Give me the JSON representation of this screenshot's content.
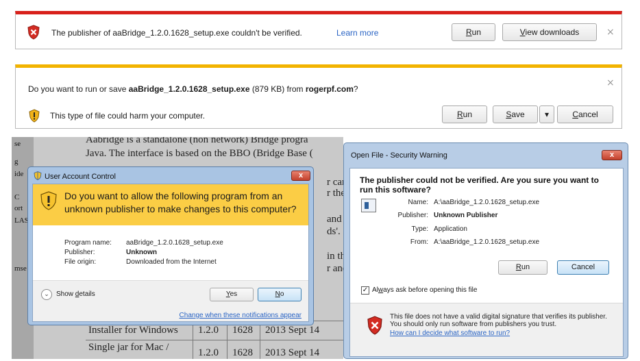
{
  "bar1": {
    "message": "The publisher of aaBridge_1.2.0.1628_setup.exe couldn't be verified.",
    "learn_more": "Learn more",
    "run_u": "R",
    "run_rest": "un",
    "view_u": "V",
    "view_rest": "iew downloads",
    "close": "×"
  },
  "bar2": {
    "q_prefix": "Do you want to run or save ",
    "q_file": "aaBridge_1.2.0.1628_setup.exe",
    "q_mid": " (879 KB) from ",
    "q_site": "rogerpf.com",
    "q_end": "?",
    "harm": "This type of file could harm your computer.",
    "run_u": "R",
    "run_rest": "un",
    "save_u": "S",
    "save_rest": "ave",
    "dropdown": "▾",
    "cancel_u": "C",
    "cancel_rest": "ancel",
    "close": "×"
  },
  "bgpage": {
    "strip": [
      "se",
      "g",
      "ide",
      "C",
      "ort",
      "LAS",
      "",
      "mse"
    ],
    "lines": [
      "Aabridge is a standalone (non network) Bridge progra",
      "Java. The interface is based on the BBO (Bridge Base (",
      "r car",
      "r the",
      "and c",
      "ds'.",
      "in th",
      "r and"
    ],
    "rows": [
      {
        "c1": "Installer for Windows",
        "c2": "1.2.0",
        "c3": "1628",
        "c4": "2013 Sept 14"
      },
      {
        "c1": "Single jar for Mac /",
        "c2": "1.2.0",
        "c3": "1628",
        "c4": "2013 Sept 14"
      }
    ]
  },
  "uac": {
    "title": "User Account Control",
    "question": "Do you want to allow the following program from an unknown publisher to make changes to this computer?",
    "program_label": "Program name:",
    "program_value": "aaBridge_1.2.0.1628_setup.exe",
    "publisher_label": "Publisher:",
    "publisher_value": "Unknown",
    "origin_label": "File origin:",
    "origin_value": "Downloaded from the Internet",
    "show_prefix": "Show ",
    "show_u": "d",
    "show_rest": "etails",
    "yes_u": "Y",
    "yes_rest": "es",
    "no_u": "N",
    "no_rest": "o",
    "change_link": "Change when these notifications appear",
    "close": "x"
  },
  "security": {
    "title": "Open File - Security Warning",
    "question": "The publisher could not be verified.  Are you sure you want to run this software?",
    "name_label": "Name:",
    "name_value": "A:\\aaBridge_1.2.0.1628_setup.exe",
    "publisher_label": "Publisher:",
    "publisher_value": "Unknown Publisher",
    "type_label": "Type:",
    "type_value": "Application",
    "from_label": "From:",
    "from_value": "A:\\aaBridge_1.2.0.1628_setup.exe",
    "run_u": "R",
    "run_rest": "un",
    "cancel": "Cancel",
    "checkbox_mark": "✓",
    "always_prefix": "Al",
    "always_u": "w",
    "always_rest": "ays ask before opening this file",
    "warning_text": "This file does not have a valid digital signature that verifies its publisher.  You should only run software from publishers you trust.",
    "warning_link": "How can I decide what software to run?",
    "close": "x"
  }
}
